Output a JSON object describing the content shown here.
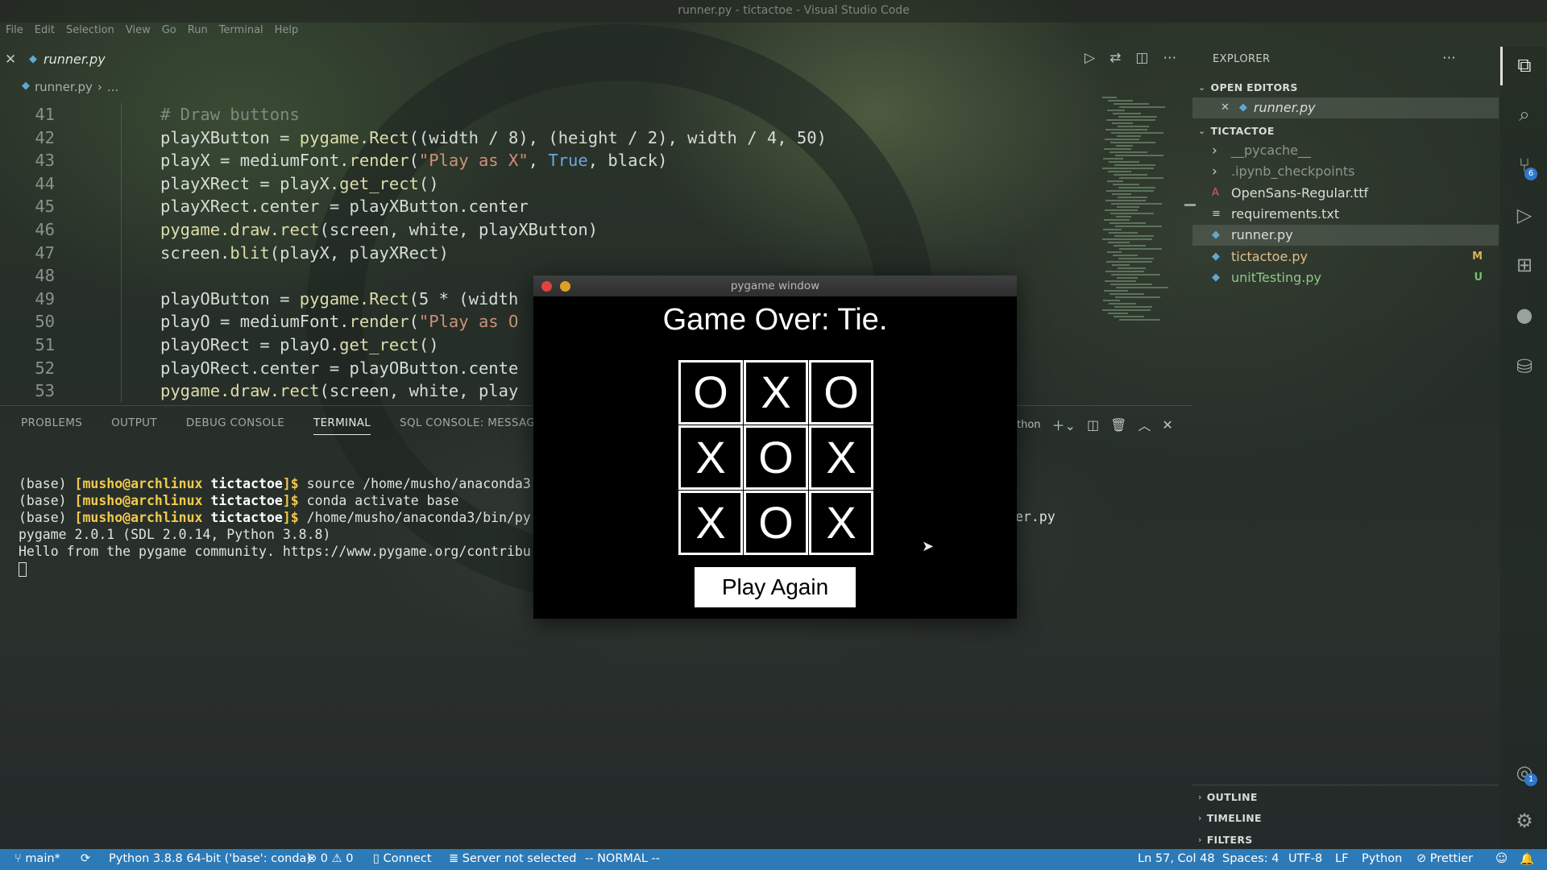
{
  "window": {
    "title": "runner.py - tictactoe - Visual Studio Code"
  },
  "menu": [
    "File",
    "Edit",
    "Selection",
    "View",
    "Go",
    "Run",
    "Terminal",
    "Help"
  ],
  "tab": {
    "name": "runner.py"
  },
  "breadcrumb": {
    "file": "runner.py",
    "rest": "..."
  },
  "code": [
    {
      "n": "41",
      "tokens": [
        [
          "com",
          "# Draw buttons"
        ]
      ]
    },
    {
      "n": "42",
      "tokens": [
        [
          "tx",
          "playXButton = "
        ],
        [
          "fn",
          "pygame.Rect"
        ],
        [
          "tx",
          "(("
        ],
        [
          "tx",
          "width / 8"
        ],
        [
          "tx",
          "), ("
        ],
        [
          "tx",
          "height / 2"
        ],
        [
          "tx",
          "), width / 4, 50)"
        ]
      ]
    },
    {
      "n": "43",
      "tokens": [
        [
          "tx",
          "playX = mediumFont."
        ],
        [
          "fn",
          "render"
        ],
        [
          "tx",
          "("
        ],
        [
          "str",
          "\"Play as X\""
        ],
        [
          "tx",
          ", "
        ],
        [
          "kw",
          "True"
        ],
        [
          "tx",
          ", black)"
        ]
      ]
    },
    {
      "n": "44",
      "tokens": [
        [
          "tx",
          "playXRect = playX."
        ],
        [
          "fn",
          "get_rect"
        ],
        [
          "tx",
          "()"
        ]
      ]
    },
    {
      "n": "45",
      "tokens": [
        [
          "tx",
          "playXRect.center = playXButton.center"
        ]
      ]
    },
    {
      "n": "46",
      "tokens": [
        [
          "fn",
          "pygame.draw.rect"
        ],
        [
          "tx",
          "(screen, white, playXButton)"
        ]
      ]
    },
    {
      "n": "47",
      "tokens": [
        [
          "tx",
          "screen."
        ],
        [
          "fn",
          "blit"
        ],
        [
          "tx",
          "(playX, playXRect)"
        ]
      ]
    },
    {
      "n": "48",
      "tokens": []
    },
    {
      "n": "49",
      "tokens": [
        [
          "tx",
          "playOButton = "
        ],
        [
          "fn",
          "pygame.Rect"
        ],
        [
          "tx",
          "(5 * (width"
        ]
      ]
    },
    {
      "n": "50",
      "tokens": [
        [
          "tx",
          "playO = mediumFont."
        ],
        [
          "fn",
          "render"
        ],
        [
          "tx",
          "("
        ],
        [
          "str",
          "\"Play as O"
        ]
      ]
    },
    {
      "n": "51",
      "tokens": [
        [
          "tx",
          "playORect = playO."
        ],
        [
          "fn",
          "get_rect"
        ],
        [
          "tx",
          "()"
        ]
      ]
    },
    {
      "n": "52",
      "tokens": [
        [
          "tx",
          "playORect.center = playOButton.cente"
        ]
      ]
    },
    {
      "n": "53",
      "tokens": [
        [
          "fn",
          "pygame.draw.rect"
        ],
        [
          "tx",
          "(screen, white, play"
        ]
      ]
    }
  ],
  "panel": {
    "tabs": [
      "PROBLEMS",
      "OUTPUT",
      "DEBUG CONSOLE",
      "TERMINAL",
      "SQL CONSOLE: MESSAGES"
    ],
    "active_tab": "TERMINAL",
    "shell_label": "thon"
  },
  "terminal": [
    {
      "prefix": "(base) ",
      "user": "[musho@archlinux",
      "dir": " tictactoe",
      "suffix": "]$ ",
      "cmd": "source /home/musho/anaconda3"
    },
    {
      "prefix": "(base) ",
      "user": "[musho@archlinux",
      "dir": " tictactoe",
      "suffix": "]$ ",
      "cmd": "conda activate base"
    },
    {
      "prefix": "(base) ",
      "user": "[musho@archlinux",
      "dir": " tictactoe",
      "suffix": "]$ ",
      "cmd": "/home/musho/anaconda3/bin/py"
    },
    {
      "plain": "pygame 2.0.1 (SDL 2.0.14, Python 3.8.8)"
    },
    {
      "plain": "Hello from the pygame community. https://www.pygame.org/contribu"
    }
  ],
  "terminal_overflow": "er.py",
  "pygame": {
    "title": "pygame window",
    "heading": "Game Over: Tie.",
    "board": [
      "O",
      "X",
      "O",
      "X",
      "O",
      "X",
      "X",
      "O",
      "X"
    ],
    "button": "Play Again"
  },
  "explorer": {
    "title": "EXPLORER",
    "open_editors_header": "OPEN EDITORS",
    "open_editor": "runner.py",
    "folder_header": "TICTACTOE",
    "items": [
      {
        "name": "__pycache__",
        "kind": "folder"
      },
      {
        "name": ".ipynb_checkpoints",
        "kind": "folder"
      },
      {
        "name": "OpenSans-Regular.ttf",
        "kind": "font"
      },
      {
        "name": "requirements.txt",
        "kind": "text"
      },
      {
        "name": "runner.py",
        "kind": "py",
        "selected": true
      },
      {
        "name": "tictactoe.py",
        "kind": "py",
        "badge": "M"
      },
      {
        "name": "unitTesting.py",
        "kind": "py",
        "badge": "U"
      }
    ],
    "outline": "OUTLINE",
    "timeline": "TIMELINE",
    "filters": "FILTERS"
  },
  "activity": {
    "scm_badge": "6",
    "accounts_badge": "1"
  },
  "status": {
    "branch": "main*",
    "python": "Python 3.8.8 64-bit ('base': conda)",
    "errors": "0",
    "warnings": "0",
    "connect": "Connect",
    "server": "Server not selected",
    "mode": "-- NORMAL --",
    "position": "Ln 57, Col 48",
    "spaces": "Spaces: 4",
    "encoding": "UTF-8",
    "eol": "LF",
    "language": "Python",
    "prettier": "Prettier"
  },
  "colors": {
    "statusbar": "#2c7ab8",
    "modified": "#d7b354",
    "untracked": "#79c06f"
  },
  "icons": [
    "close-icon",
    "python-file-icon",
    "run-icon",
    "compare-icon",
    "split-editor-icon",
    "more-icon",
    "files-icon",
    "search-icon",
    "source-control-icon",
    "run-debug-icon",
    "extensions-icon",
    "github-icon",
    "database-icon",
    "accounts-icon",
    "settings-gear-icon"
  ]
}
